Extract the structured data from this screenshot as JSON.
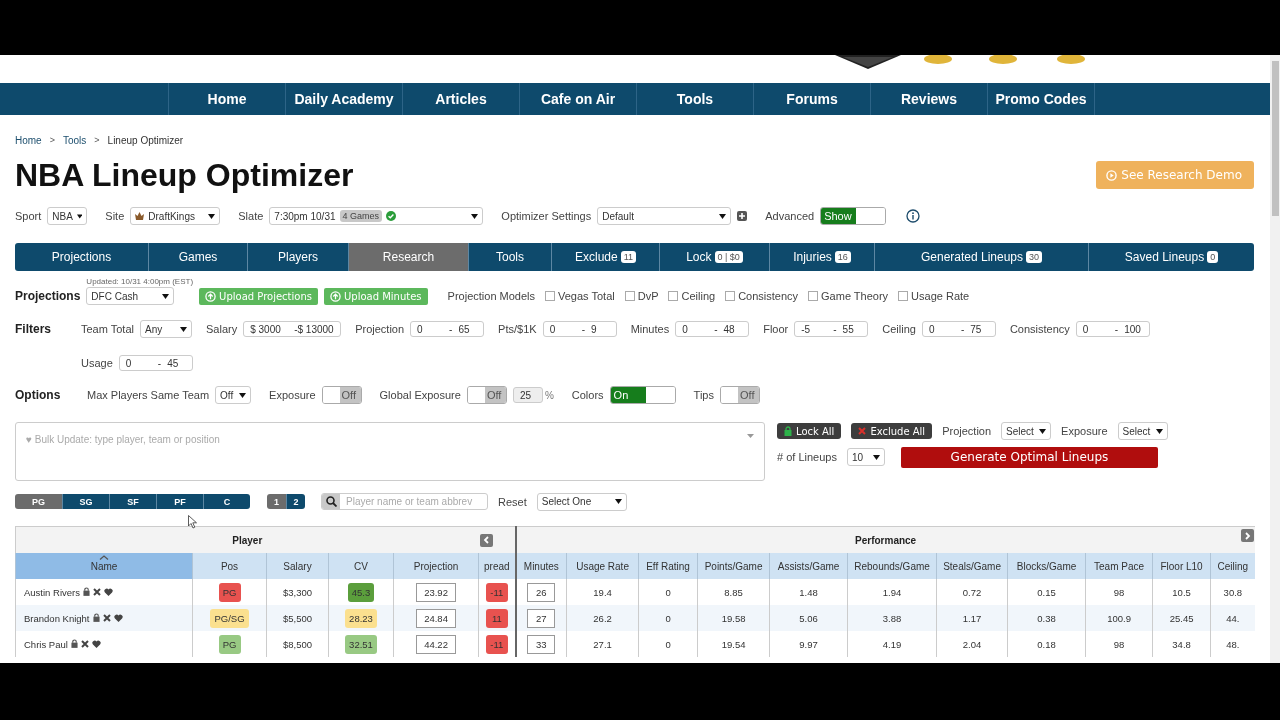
{
  "nav": [
    "Home",
    "Daily Academy",
    "Articles",
    "Cafe on Air",
    "Tools",
    "Forums",
    "Reviews",
    "Promo Codes"
  ],
  "breadcrumb": {
    "items": [
      "Home",
      "Tools",
      "Lineup Optimizer"
    ],
    "separator": ">"
  },
  "title": "NBA Lineup Optimizer",
  "demo_button": "See Research Demo",
  "settings": {
    "sport": {
      "label": "Sport",
      "value": "NBA"
    },
    "site": {
      "label": "Site",
      "value": "DraftKings"
    },
    "slate": {
      "label": "Slate",
      "value": "7:30pm 10/31",
      "badge": "4 Games"
    },
    "optimizer": {
      "label": "Optimizer Settings",
      "value": "Default"
    },
    "advanced": {
      "label": "Advanced",
      "text": "Show",
      "on": true
    }
  },
  "tabs": [
    {
      "label": "Projections",
      "selected": false
    },
    {
      "label": "Games",
      "selected": false
    },
    {
      "label": "Players",
      "selected": false
    },
    {
      "label": "Research",
      "selected": true
    },
    {
      "label": "Tools",
      "selected": false
    },
    {
      "label": "Exclude",
      "badge": "11",
      "selected": false
    },
    {
      "label": "Lock",
      "badge": "0 | $0",
      "selected": false
    },
    {
      "label": "Injuries",
      "badge": "16",
      "selected": false
    },
    {
      "label": "Generated Lineups",
      "badge": "30",
      "selected": false
    },
    {
      "label": "Saved Lineups",
      "badge": "0",
      "selected": false
    }
  ],
  "projections": {
    "label": "Projections",
    "updated": "Updated: 10/31 4:00pm (EST)",
    "value": "DFC Cash",
    "buttons": [
      "Upload Projections",
      "Upload Minutes"
    ],
    "models_label": "Projection Models",
    "models": [
      {
        "label": "Vegas Total",
        "checked": false
      },
      {
        "label": "DvP",
        "checked": false
      },
      {
        "label": "Ceiling",
        "checked": false
      },
      {
        "label": "Consistency",
        "checked": false
      },
      {
        "label": "Game Theory",
        "checked": false
      },
      {
        "label": "Usage Rate",
        "checked": false
      }
    ]
  },
  "filters": {
    "label": "Filters",
    "team_total": {
      "label": "Team Total",
      "value": "Any"
    },
    "ranges": [
      {
        "label": "Salary",
        "from": "$ 3000",
        "sep": "-",
        "to": "$ 13000"
      },
      {
        "label": "Projection",
        "from": "0",
        "sep": "-",
        "to": "65"
      },
      {
        "label": "Pts/$1K",
        "from": "0",
        "sep": "-",
        "to": "9"
      },
      {
        "label": "Minutes",
        "from": "0",
        "sep": "-",
        "to": "48"
      },
      {
        "label": "Floor",
        "from": "-5",
        "sep": "-",
        "to": "55"
      },
      {
        "label": "Ceiling",
        "from": "0",
        "sep": "-",
        "to": "75"
      },
      {
        "label": "Consistency",
        "from": "0",
        "sep": "-",
        "to": "100"
      },
      {
        "label": "Usage",
        "from": "0",
        "sep": "-",
        "to": "45"
      }
    ]
  },
  "options": {
    "label": "Options",
    "max_players": {
      "label": "Max Players Same Team",
      "value": "Off"
    },
    "toggles": [
      {
        "label": "Exposure",
        "text": "Off",
        "on": false
      },
      {
        "label": "Global Exposure",
        "text": "Off",
        "on": false,
        "value": "25",
        "unit": "%"
      },
      {
        "label": "Colors",
        "text": "On",
        "on": true
      },
      {
        "label": "Tips",
        "text": "Off",
        "on": false
      }
    ]
  },
  "bulk": {
    "placeholder": "♥ Bulk Update: type player, team or position"
  },
  "actions": {
    "lock_all": "Lock All",
    "exclude_all": "Exclude All",
    "projection": {
      "label": "Projection",
      "value": "Select"
    },
    "exposure": {
      "label": "Exposure",
      "value": "Select"
    },
    "lineups": {
      "label": "# of Lineups",
      "value": "10"
    },
    "generate": "Generate Optimal Lineups"
  },
  "positions": [
    {
      "label": "PG",
      "selected": true
    },
    {
      "label": "SG",
      "selected": false
    },
    {
      "label": "SF",
      "selected": false
    },
    {
      "label": "PF",
      "selected": false
    },
    {
      "label": "C",
      "selected": false
    }
  ],
  "pages": [
    {
      "label": "1",
      "selected": true
    },
    {
      "label": "2",
      "selected": false
    }
  ],
  "search": {
    "placeholder": "Player name or team abbrev"
  },
  "reset": {
    "label": "Reset",
    "value": "Select One"
  },
  "table": {
    "groups": [
      "Player",
      "Performance"
    ],
    "columns": [
      {
        "label": "Name",
        "sorted": true
      },
      {
        "label": "Pos",
        "sorted": false
      },
      {
        "label": "Salary",
        "sorted": false
      },
      {
        "label": "CV",
        "sorted": false
      },
      {
        "label": "Projection",
        "sorted": false
      },
      {
        "label": "pread",
        "sorted": false
      },
      {
        "label": "Minutes",
        "sorted": false
      },
      {
        "label": "Usage Rate",
        "sorted": false
      },
      {
        "label": "Eff Rating",
        "sorted": false
      },
      {
        "label": "Points/Game",
        "sorted": false
      },
      {
        "label": "Assists/Game",
        "sorted": false
      },
      {
        "label": "Rebounds/Game",
        "sorted": false
      },
      {
        "label": "Steals/Game",
        "sorted": false
      },
      {
        "label": "Blocks/Game",
        "sorted": false
      },
      {
        "label": "Team Pace",
        "sorted": false
      },
      {
        "label": "Floor L10",
        "sorted": false
      },
      {
        "label": "Ceiling",
        "sorted": false
      }
    ],
    "rows": [
      [
        {
          "kind": "player",
          "text": "Austin Rivers"
        },
        {
          "kind": "tag",
          "text": "PG",
          "color": "#e8524f"
        },
        {
          "kind": "text",
          "text": "$3,300"
        },
        {
          "kind": "tag",
          "text": "45.3",
          "color": "#5b9e3c"
        },
        {
          "kind": "input",
          "text": "23.92"
        },
        {
          "kind": "tag",
          "text": "-11",
          "color": "#e8524f"
        },
        {
          "kind": "input",
          "text": "26"
        },
        {
          "kind": "text",
          "text": "19.4"
        },
        {
          "kind": "text",
          "text": "0"
        },
        {
          "kind": "text",
          "text": "8.85"
        },
        {
          "kind": "text",
          "text": "1.48"
        },
        {
          "kind": "text",
          "text": "1.94"
        },
        {
          "kind": "text",
          "text": "0.72"
        },
        {
          "kind": "text",
          "text": "0.15"
        },
        {
          "kind": "text",
          "text": "98"
        },
        {
          "kind": "text",
          "text": "10.5"
        },
        {
          "kind": "text",
          "text": "30.8"
        }
      ],
      [
        {
          "kind": "player",
          "text": "Brandon Knight"
        },
        {
          "kind": "tag",
          "text": "PG/SG",
          "color": "#fbe08f"
        },
        {
          "kind": "text",
          "text": "$5,500"
        },
        {
          "kind": "tag",
          "text": "28.23",
          "color": "#fbe08f"
        },
        {
          "kind": "input",
          "text": "24.84"
        },
        {
          "kind": "tag",
          "text": "11",
          "color": "#e8524f"
        },
        {
          "kind": "input",
          "text": "27"
        },
        {
          "kind": "text",
          "text": "26.2"
        },
        {
          "kind": "text",
          "text": "0"
        },
        {
          "kind": "text",
          "text": "19.58"
        },
        {
          "kind": "text",
          "text": "5.06"
        },
        {
          "kind": "text",
          "text": "3.88"
        },
        {
          "kind": "text",
          "text": "1.17"
        },
        {
          "kind": "text",
          "text": "0.38"
        },
        {
          "kind": "text",
          "text": "100.9"
        },
        {
          "kind": "text",
          "text": "25.45"
        },
        {
          "kind": "text",
          "text": "44."
        }
      ],
      [
        {
          "kind": "player",
          "text": "Chris Paul"
        },
        {
          "kind": "tag",
          "text": "PG",
          "color": "#98c983"
        },
        {
          "kind": "text",
          "text": "$8,500"
        },
        {
          "kind": "tag",
          "text": "32.51",
          "color": "#98c983"
        },
        {
          "kind": "input",
          "text": "44.22"
        },
        {
          "kind": "tag",
          "text": "-11",
          "color": "#e8524f"
        },
        {
          "kind": "input",
          "text": "33"
        },
        {
          "kind": "text",
          "text": "27.1"
        },
        {
          "kind": "text",
          "text": "0"
        },
        {
          "kind": "text",
          "text": "19.54"
        },
        {
          "kind": "text",
          "text": "9.97"
        },
        {
          "kind": "text",
          "text": "4.19"
        },
        {
          "kind": "text",
          "text": "2.04"
        },
        {
          "kind": "text",
          "text": "0.18"
        },
        {
          "kind": "text",
          "text": "98"
        },
        {
          "kind": "text",
          "text": "34.8"
        },
        {
          "kind": "text",
          "text": "48."
        }
      ]
    ]
  }
}
